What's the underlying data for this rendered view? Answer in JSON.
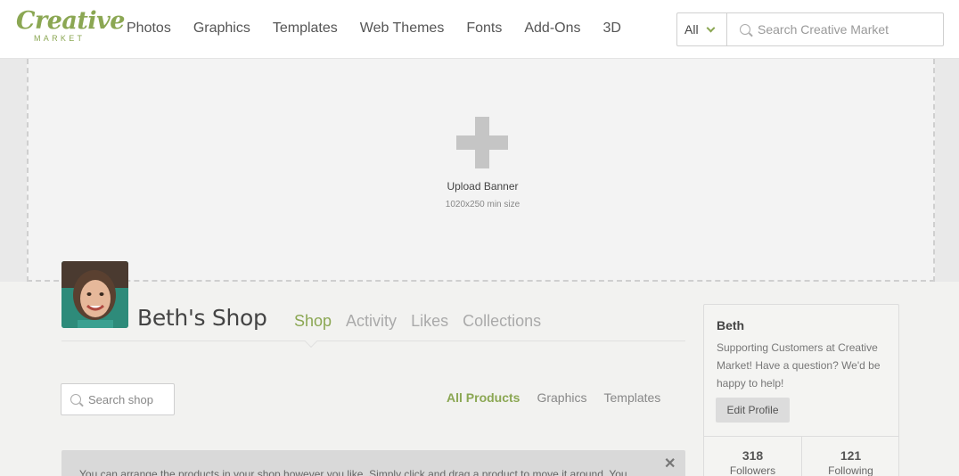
{
  "header": {
    "logo_main": "Creative",
    "logo_sub": "MARKET",
    "nav": [
      "Photos",
      "Graphics",
      "Templates",
      "Web Themes",
      "Fonts",
      "Add-Ons",
      "3D"
    ],
    "search_category": "All",
    "search_placeholder": "Search Creative Market"
  },
  "banner": {
    "title": "Upload Banner",
    "subtitle": "1020x250 min size"
  },
  "profile": {
    "shop_name": "Beth's Shop",
    "tabs": [
      "Shop",
      "Activity",
      "Likes",
      "Collections"
    ],
    "active_tab": "Shop"
  },
  "shop": {
    "search_placeholder": "Search shop",
    "filters": [
      "All Products",
      "Graphics",
      "Templates"
    ],
    "active_filter": "All Products",
    "notice": "You can arrange the products in your shop however you like. Simply click and drag a product to move it around. You",
    "close_symbol": "✕"
  },
  "card": {
    "name": "Beth",
    "bio": "Supporting Customers at Creative Market! Have a question? We'd be happy to help!",
    "edit_label": "Edit Profile",
    "followers_count": "318",
    "followers_label": "Followers",
    "following_count": "121",
    "following_label": "Following"
  },
  "colors": {
    "accent": "#8ba753",
    "avatar_bg": "#2e8b7a"
  },
  "icons": {
    "search": "search-icon",
    "chevron": "chevron-down-icon",
    "upload": "plus-icon",
    "close": "close-icon"
  }
}
